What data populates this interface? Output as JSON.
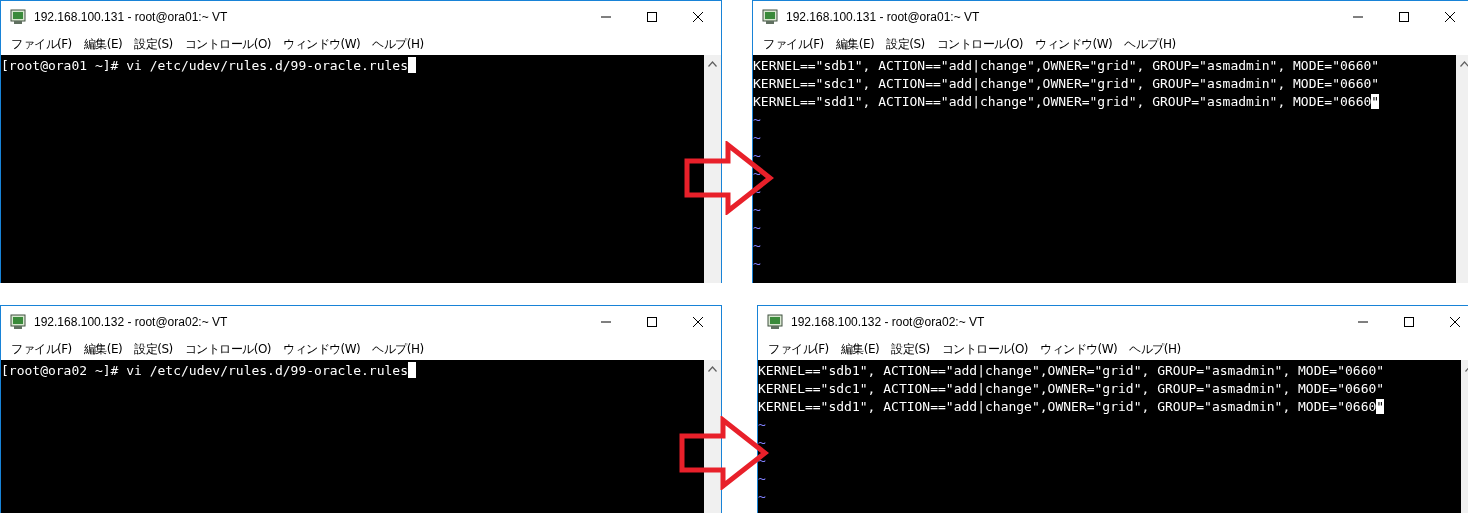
{
  "rows": [
    {
      "windows": [
        {
          "title": "192.168.100.131 - root@ora01:~ VT",
          "menu": [
            "ファイル(F)",
            "編集(E)",
            "設定(S)",
            "コントロール(O)",
            "ウィンドウ(W)",
            "ヘルプ(H)"
          ],
          "lines": [
            {
              "kind": "text",
              "text": "[root@ora01 ~]# vi /etc/udev/rules.d/99-oracle.rules",
              "cursor_after_text": true
            }
          ]
        },
        {
          "title": "192.168.100.131 - root@ora01:~ VT",
          "menu": [
            "ファイル(F)",
            "編集(E)",
            "設定(S)",
            "コントロール(O)",
            "ウィンドウ(W)",
            "ヘルプ(H)"
          ],
          "lines": [
            {
              "kind": "text",
              "text": "KERNEL==\"sdb1\", ACTION==\"add|change\",OWNER=\"grid\", GROUP=\"asmadmin\", MODE=\"0660\""
            },
            {
              "kind": "text",
              "text": "KERNEL==\"sdc1\", ACTION==\"add|change\",OWNER=\"grid\", GROUP=\"asmadmin\", MODE=\"0660\""
            },
            {
              "kind": "text",
              "text": "KERNEL==\"sdd1\", ACTION==\"add|change\",OWNER=\"grid\", GROUP=\"asmadmin\", MODE=\"0660\"",
              "cursor_on_last_char": true
            },
            {
              "kind": "filler",
              "text": "~"
            },
            {
              "kind": "filler",
              "text": "~"
            },
            {
              "kind": "filler",
              "text": "~"
            },
            {
              "kind": "filler",
              "text": "~"
            },
            {
              "kind": "filler",
              "text": "~"
            },
            {
              "kind": "filler",
              "text": "~"
            },
            {
              "kind": "filler",
              "text": "~"
            },
            {
              "kind": "filler",
              "text": "~"
            },
            {
              "kind": "filler",
              "text": "~"
            }
          ]
        }
      ]
    },
    {
      "windows": [
        {
          "title": "192.168.100.132 - root@ora02:~ VT",
          "menu": [
            "ファイル(F)",
            "編集(E)",
            "設定(S)",
            "コントロール(O)",
            "ウィンドウ(W)",
            "ヘルプ(H)"
          ],
          "lines": [
            {
              "kind": "text",
              "text": "[root@ora02 ~]# vi /etc/udev/rules.d/99-oracle.rules",
              "cursor_after_text": true
            }
          ]
        },
        {
          "title": "192.168.100.132 - root@ora02:~ VT",
          "menu": [
            "ファイル(F)",
            "編集(E)",
            "設定(S)",
            "コントロール(O)",
            "ウィンドウ(W)",
            "ヘルプ(H)"
          ],
          "lines": [
            {
              "kind": "text",
              "text": "KERNEL==\"sdb1\", ACTION==\"add|change\",OWNER=\"grid\", GROUP=\"asmadmin\", MODE=\"0660\""
            },
            {
              "kind": "text",
              "text": "KERNEL==\"sdc1\", ACTION==\"add|change\",OWNER=\"grid\", GROUP=\"asmadmin\", MODE=\"0660\""
            },
            {
              "kind": "text",
              "text": "KERNEL==\"sdd1\", ACTION==\"add|change\",OWNER=\"grid\", GROUP=\"asmadmin\", MODE=\"0660\"",
              "cursor_on_last_char": true
            },
            {
              "kind": "filler",
              "text": "~"
            },
            {
              "kind": "filler",
              "text": "~"
            },
            {
              "kind": "filler",
              "text": "~"
            },
            {
              "kind": "filler",
              "text": "~"
            },
            {
              "kind": "filler",
              "text": "~"
            }
          ]
        }
      ]
    }
  ]
}
